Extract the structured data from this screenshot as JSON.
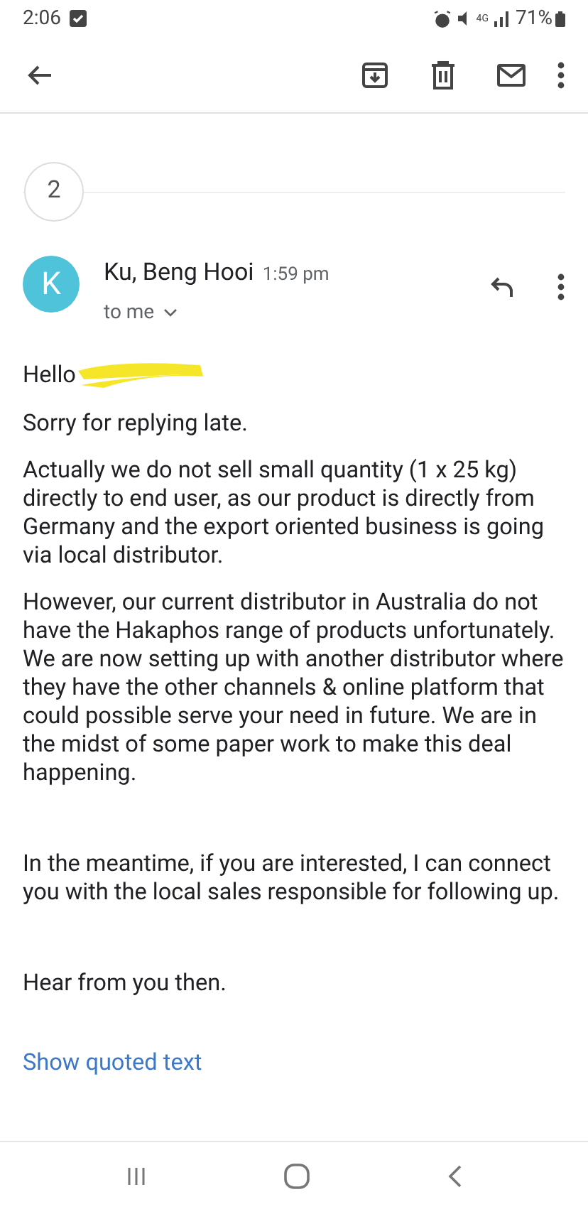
{
  "status_bar": {
    "time": "2:06",
    "network": "4G",
    "battery": "71%"
  },
  "thread": {
    "collapsed_count": "2"
  },
  "message": {
    "avatar_letter": "K",
    "sender": "Ku, Beng Hooi",
    "time": "1:59 pm",
    "recipient": "to me"
  },
  "body": {
    "greeting": "Hello",
    "paragraphs": [
      {
        "text": "Sorry for replying late.",
        "kind": "plain"
      },
      {
        "text": "Actually we do not sell small quantity (1 x 25 kg) directly to end user, as our product is directly from Germany and the export oriented business is going via local distributor.",
        "kind": "plain"
      },
      {
        "text": "However, our current distributor in Australia do not have the Hakaphos range of products unfortunately. We are now setting up with another distributor where they have the other channels & online platform that could possible serve your need in future. We are in the midst of some paper work to make this deal happening.",
        "kind": "plain"
      },
      {
        "text": "In the meantime, if you are interested, I can connect you with the local sales responsible for following up.",
        "kind": "spaced"
      },
      {
        "text": "Hear from you then.",
        "kind": "spaced"
      }
    ]
  },
  "show_quoted": "Show quoted text"
}
